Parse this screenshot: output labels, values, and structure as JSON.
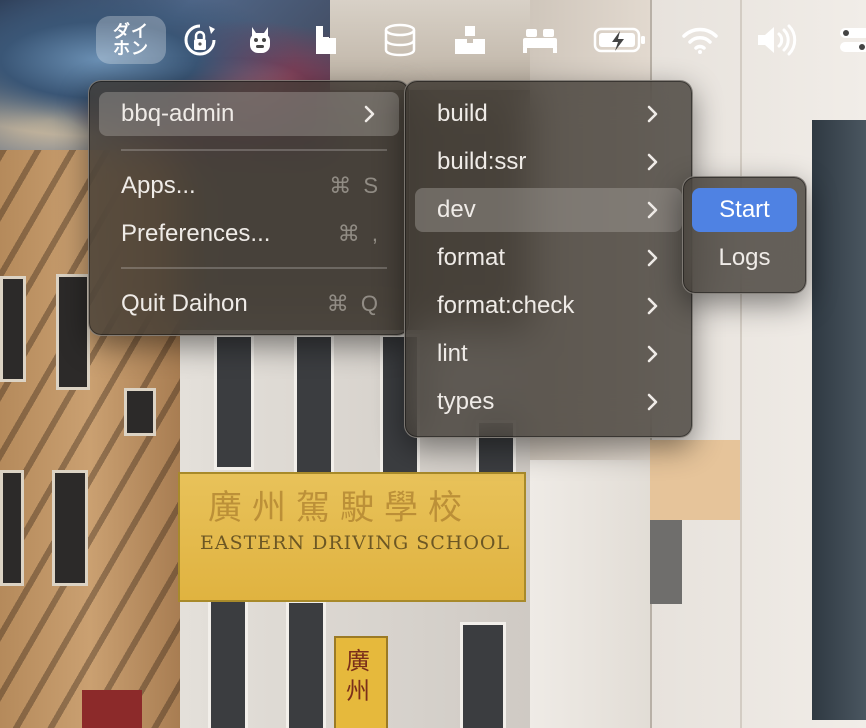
{
  "menubar": {
    "app_label_line1": "ダイ",
    "app_label_line2": "ホン",
    "icons": [
      "lock-refresh-icon",
      "mascot-icon",
      "h-logo-icon",
      "database-icon",
      "upload-box-icon",
      "bed-icon",
      "battery-charging-icon",
      "wifi-icon",
      "volume-icon",
      "toggles-icon"
    ]
  },
  "main_menu": {
    "project_label": "bbq-admin",
    "apps_label": "Apps...",
    "apps_shortcut": "⌘ S",
    "preferences_label": "Preferences...",
    "preferences_shortcut": "⌘ ,",
    "quit_label": "Quit Daihon",
    "quit_shortcut": "⌘ Q"
  },
  "scripts_menu": {
    "items": [
      {
        "label": "build"
      },
      {
        "label": "build:ssr"
      },
      {
        "label": "dev"
      },
      {
        "label": "format"
      },
      {
        "label": "format:check"
      },
      {
        "label": "lint"
      },
      {
        "label": "types"
      }
    ]
  },
  "action_menu": {
    "start_label": "Start",
    "logs_label": "Logs"
  },
  "colors": {
    "selection": "#4f82e3",
    "menu_bg": "#3e3832"
  }
}
